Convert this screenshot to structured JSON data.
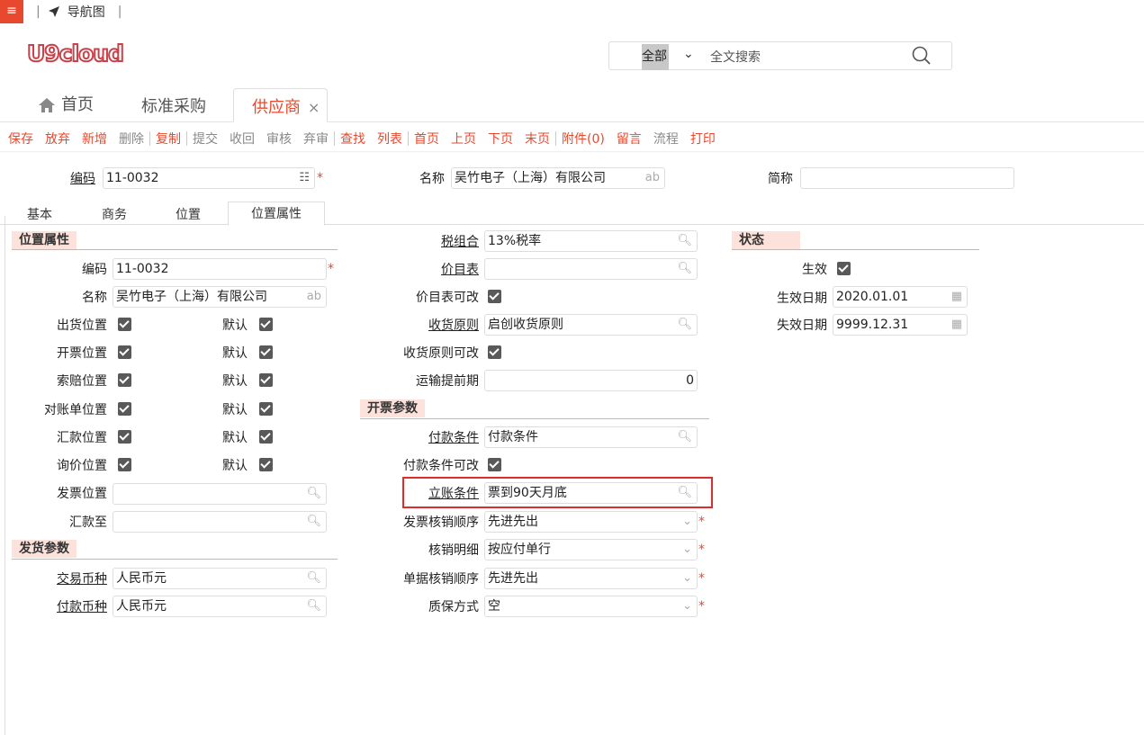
{
  "topbar": {
    "menu_glyph": "≡",
    "nav_label": "导航图"
  },
  "logo": "U9cloud",
  "search": {
    "scope": "全部",
    "placeholder": "全文搜索"
  },
  "tabs": {
    "home": "首页",
    "std": "标准采购",
    "active": "供应商",
    "close": "×"
  },
  "toolbar": [
    "保存",
    "放弃",
    "新增",
    "删除",
    "复制",
    "提交",
    "收回",
    "审核",
    "弃审",
    "查找",
    "列表",
    "首页",
    "上页",
    "下页",
    "末页",
    "附件(0)",
    "留言",
    "流程",
    "打印"
  ],
  "header": {
    "code_label": "编码",
    "code_value": "11-0032",
    "name_label": "名称",
    "name_value": "吴竹电子（上海）有限公司",
    "short_label": "简称",
    "short_value": ""
  },
  "subtabs": [
    "基本",
    "商务",
    "位置",
    "位置属性"
  ],
  "loc": {
    "section": "位置属性",
    "code_label": "编码",
    "code_value": "11-0032",
    "name_label": "名称",
    "name_value": "吴竹电子（上海）有限公司",
    "rows": [
      {
        "label": "出货位置",
        "default": "默认"
      },
      {
        "label": "开票位置",
        "default": "默认"
      },
      {
        "label": "索赔位置",
        "default": "默认"
      },
      {
        "label": "对账单位置",
        "default": "默认"
      },
      {
        "label": "汇款位置",
        "default": "默认"
      },
      {
        "label": "询价位置",
        "default": "默认"
      }
    ],
    "invoice_loc_label": "发票位置",
    "remit_to_label": "汇款至"
  },
  "ship": {
    "section": "发货参数",
    "currency_label": "交易币种",
    "currency_value": "人民币元",
    "pay_currency_label": "付款币种",
    "pay_currency_value": "人民币元"
  },
  "mid": {
    "tax_label": "税组合",
    "tax_value": "13%税率",
    "pricelist_label": "价目表",
    "pricelist_value": "",
    "pricelist_edit_label": "价目表可改",
    "receive_label": "收货原则",
    "receive_value": "启创收货原则",
    "receive_edit_label": "收货原则可改",
    "lead_label": "运输提前期",
    "lead_value": "0",
    "invoice_section": "开票参数",
    "payterm_label": "付款条件",
    "payterm_value": "付款条件",
    "payterm_edit_label": "付款条件可改",
    "account_label": "立账条件",
    "account_value": "票到90天月底",
    "inv_order_label": "发票核销顺序",
    "inv_order_value": "先进先出",
    "detail_label": "核销明细",
    "detail_value": "按应付单行",
    "doc_order_label": "单据核销顺序",
    "doc_order_value": "先进先出",
    "warranty_label": "质保方式",
    "warranty_value": "空"
  },
  "status": {
    "section": "状态",
    "effective_label": "生效",
    "eff_date_label": "生效日期",
    "eff_date_value": "2020.01.01",
    "exp_date_label": "失效日期",
    "exp_date_value": "9999.12.31"
  },
  "colors": {
    "accent": "#e8492e",
    "section_bg": "#fde2dc",
    "highlight": "#e02b2b"
  }
}
